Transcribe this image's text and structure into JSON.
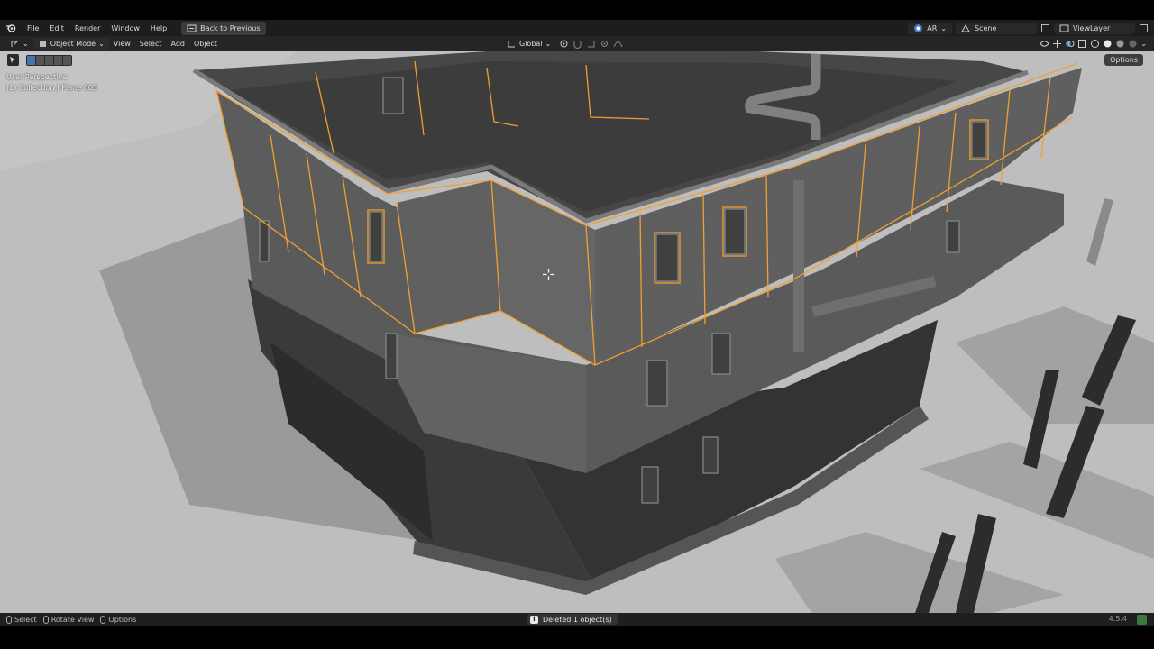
{
  "menubar": {
    "items": [
      "File",
      "Edit",
      "Render",
      "Window",
      "Help"
    ],
    "back_button": "Back to Previous",
    "renderer_short": "AR",
    "scene": "Scene",
    "view_layer": "ViewLayer"
  },
  "header": {
    "mode": "Object Mode",
    "menus": [
      "View",
      "Select",
      "Add",
      "Object"
    ],
    "transform_orientation": "Global"
  },
  "viewport": {
    "perspective_label": "User Perspective",
    "collection_label": "(1) Collection | Plane 003",
    "options_label": "Options",
    "selection_color": "#f0a030"
  },
  "statusbar": {
    "select": "Select",
    "rotate_view": "Rotate View",
    "options": "Options",
    "report": "Deleted 1 object(s)",
    "version": "4.5.4"
  },
  "icons": [
    "blender-logo-icon",
    "editor-type-icon",
    "object-mode-icon",
    "select-box-icon",
    "orientation-icon",
    "pivot-icon",
    "snap-icon",
    "proportional-icon",
    "viewport-shading-icon",
    "overlay-icon",
    "gizmo-icon",
    "scene-icon",
    "view-layer-icon",
    "cursor-crosshair-icon"
  ]
}
